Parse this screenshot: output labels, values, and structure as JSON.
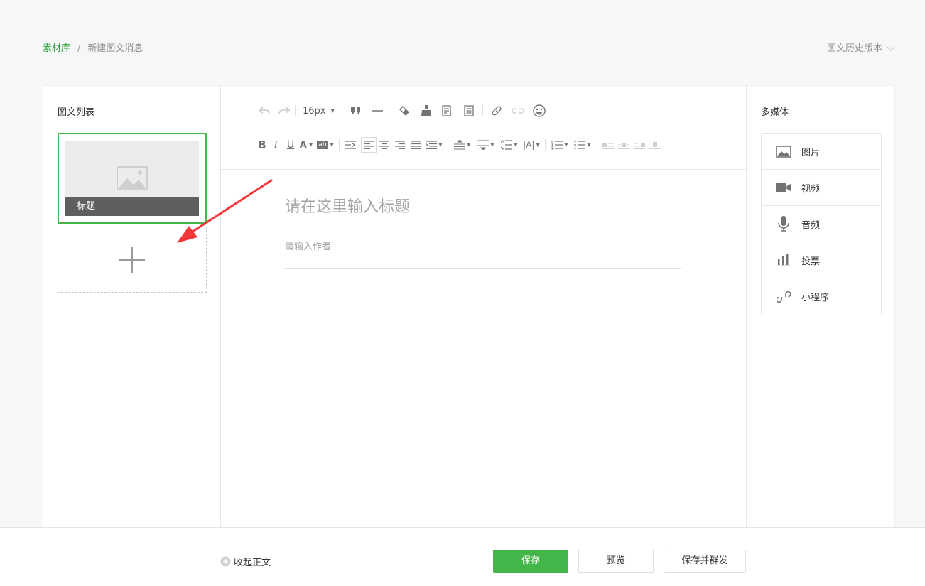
{
  "breadcrumb": {
    "root": "素材库",
    "separator": "/",
    "current": "新建图文消息"
  },
  "history_label": "图文历史版本",
  "article_list": {
    "title": "图文列表",
    "cards": [
      {
        "caption": "标题"
      }
    ]
  },
  "editor": {
    "font_size": "16px",
    "title_placeholder": "请在这里输入标题",
    "author_placeholder": "请输入作者"
  },
  "media": {
    "title": "多媒体",
    "items": [
      {
        "label": "图片",
        "icon": "image-icon"
      },
      {
        "label": "视频",
        "icon": "video-icon"
      },
      {
        "label": "音频",
        "icon": "microphone-icon"
      },
      {
        "label": "投票",
        "icon": "vote-chart-icon"
      },
      {
        "label": "小程序",
        "icon": "mini-program-icon"
      }
    ]
  },
  "footer": {
    "collapse_label": "收起正文",
    "save_label": "保存",
    "preview_label": "预览",
    "save_send_label": "保存并群发"
  },
  "colors": {
    "accent": "#44b549",
    "annotation_arrow": "#f2383b"
  }
}
